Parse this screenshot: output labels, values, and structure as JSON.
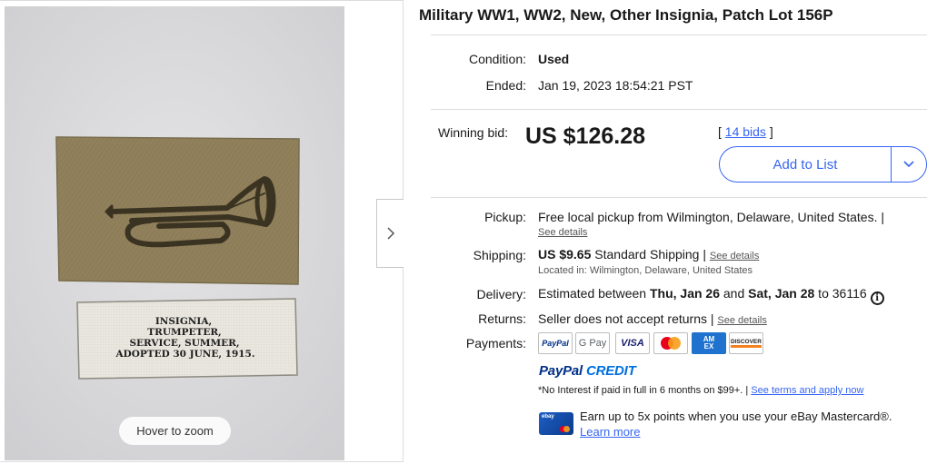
{
  "gallery": {
    "hover_zoom": "Hover to zoom",
    "label_lines": [
      "INSIGNIA,",
      "TRUMPETER,",
      "SERVICE, SUMMER,",
      "ADOPTED 30 JUNE, 1915."
    ],
    "next_icon": "chevron-right-icon"
  },
  "item": {
    "title": "Military WW1, WW2, New, Other Insignia, Patch Lot 156P",
    "condition_label": "Condition:",
    "condition_value": "Used",
    "ended_label": "Ended:",
    "ended_value": "Jan 19, 2023 18:54:21 PST"
  },
  "bidding": {
    "winning_label": "Winning bid:",
    "price": "US $126.28",
    "bids_open": "[ ",
    "bids_link": "14 bids",
    "bids_close": " ]",
    "add_to_list": "Add to List",
    "dropdown_icon": "chevron-down-icon"
  },
  "shipping": {
    "pickup_label": "Pickup:",
    "pickup_value": "Free local pickup from Wilmington, Delaware, United States. |",
    "pickup_details": "See details",
    "shipping_label": "Shipping:",
    "shipping_price": "US $9.65",
    "shipping_method": " Standard Shipping | ",
    "shipping_details": "See details",
    "located": "Located in: Wilmington, Delaware, United States",
    "delivery_label": "Delivery:",
    "delivery_prefix": "Estimated between ",
    "delivery_start": "Thu, Jan 26",
    "delivery_mid": " and ",
    "delivery_end": "Sat, Jan 28",
    "delivery_suffix": " to 36116",
    "info_icon": "info-icon",
    "returns_label": "Returns:",
    "returns_value": "Seller does not accept returns | ",
    "returns_details": "See details"
  },
  "payments": {
    "label": "Payments:",
    "methods": [
      {
        "name": "PayPal",
        "icon": "paypal-icon"
      },
      {
        "name": "G Pay",
        "icon": "google-pay-icon"
      },
      {
        "name": "VISA",
        "icon": "visa-icon"
      },
      {
        "name": "",
        "icon": "mastercard-icon"
      },
      {
        "name": "AM EX",
        "icon": "amex-icon"
      },
      {
        "name": "DISCOVER",
        "icon": "discover-icon"
      }
    ],
    "paypal_credit_1": "PayPal",
    "paypal_credit_2": " CREDIT",
    "credit_terms": "*No Interest if paid in full in 6 months on $99+. | ",
    "credit_terms_link": "See terms and apply now",
    "card_logo": "ebay",
    "card_offer": "Earn up to 5x points when you use your eBay Mastercard®.",
    "learn_more": "Learn more"
  },
  "colors": {
    "link": "#3665f3",
    "paypal_dark": "#003087",
    "paypal_light": "#0070e0",
    "patch_khaki": "#8a7a56",
    "backdrop": "#dcdcde"
  }
}
